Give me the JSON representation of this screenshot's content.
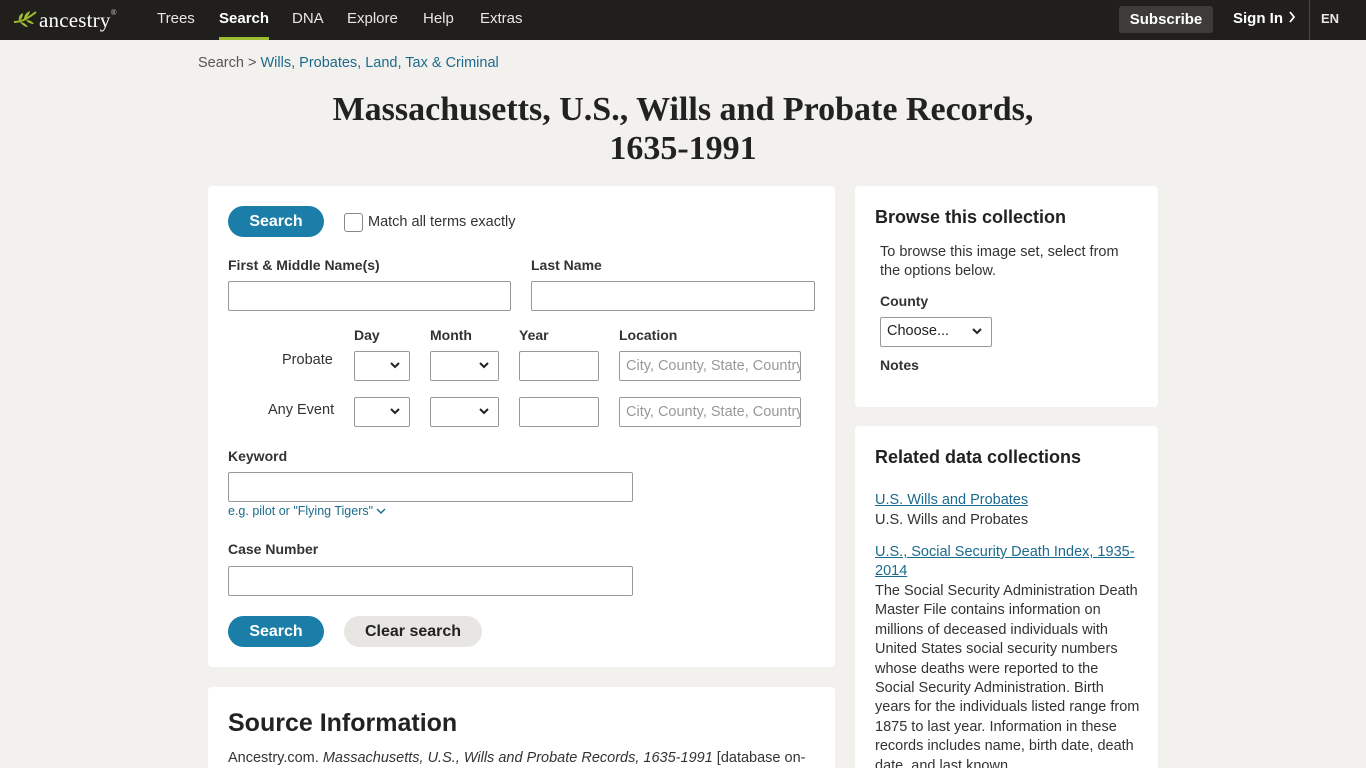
{
  "nav": {
    "logo_text": "ancestry",
    "logo_tm": "®",
    "items": [
      "Trees",
      "Search",
      "DNA",
      "Explore",
      "Help",
      "Extras"
    ],
    "active": "Search",
    "subscribe": "Subscribe",
    "signin": "Sign In",
    "lang": "EN"
  },
  "breadcrumb": {
    "root": "Search",
    "separator": ">",
    "current": "Wills, Probates, Land, Tax & Criminal"
  },
  "title_line1": "Massachusetts, U.S., Wills and Probate Records,",
  "title_line2": "1635-1991",
  "search": {
    "search_button": "Search",
    "match_exact": "Match all terms exactly",
    "first_name_label": "First & Middle Name(s)",
    "last_name_label": "Last Name",
    "col_day": "Day",
    "col_month": "Month",
    "col_year": "Year",
    "col_location": "Location",
    "row_probate": "Probate",
    "row_any_event": "Any Event",
    "location_placeholder": "City, County, State, Country",
    "keyword_label": "Keyword",
    "keyword_hint": "e.g. pilot or \"Flying Tigers\"",
    "case_number_label": "Case Number",
    "clear_button": "Clear search"
  },
  "source": {
    "heading": "Source Information",
    "text_prefix": "Ancestry.com. ",
    "text_italic": "Massachusetts, U.S., Wills and Probate Records, 1635-1991",
    "text_suffix": " [database on-"
  },
  "browse": {
    "heading": "Browse this collection",
    "description": "To browse this image set, select from the options below.",
    "county_label": "County",
    "county_value": "Choose...",
    "notes_label": "Notes"
  },
  "related": {
    "heading": "Related data collections",
    "items": [
      {
        "link": "U.S. Wills and Probates",
        "desc": "U.S. Wills and Probates"
      },
      {
        "link": "U.S., Social Security Death Index, 1935-2014",
        "desc": "The Social Security Administration Death Master File contains information on millions of deceased individuals with United States social security numbers whose deaths were reported to the Social Security Administration. Birth years for the individuals listed range from 1875 to last year. Information in these records includes name, birth date, death date, and last known"
      }
    ]
  },
  "colors": {
    "nav_bg": "#201f1c",
    "accent_green": "#9cbe30",
    "primary_blue": "#1a7ea8",
    "link_blue": "#1c6b8c",
    "page_bg": "#f3f1ed"
  }
}
